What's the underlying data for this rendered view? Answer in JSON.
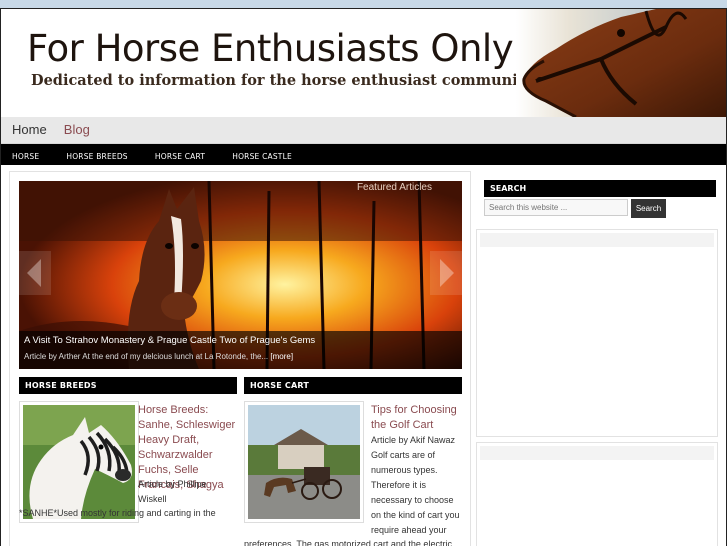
{
  "site": {
    "title": "For Horse Enthusiasts Only",
    "tagline": "Dedicated to information for the horse enthusiast community."
  },
  "primary_nav": [
    {
      "label": "Home"
    },
    {
      "label": "Blog"
    }
  ],
  "secondary_nav": [
    {
      "label": "HORSE"
    },
    {
      "label": "HORSE BREEDS"
    },
    {
      "label": "HORSE CART"
    },
    {
      "label": "HORSE CASTLE"
    }
  ],
  "slider": {
    "label": "Featured Articles",
    "title": "A Visit To Strahov Monastery & Prague Castle Two of Prague's Gems",
    "excerpt": "Article by Arther At the end of my delcious lunch at La Rotonde, the...",
    "more_label": "[more]"
  },
  "columns": [
    {
      "heading": "HORSE BREEDS",
      "post": {
        "title": "Horse Breeds: Sanhe, Schleswiger Heavy Draft, Schwarzwalder Fuchs, Selle Francais, Shagya",
        "byline": "Article by Phillipe Wiskell",
        "body": "*SANHE*Used mostly for riding and carting in the"
      }
    },
    {
      "heading": "HORSE CART",
      "post": {
        "title": "Tips for Choosing the Golf Cart",
        "byline": "Article by Akif Nawaz Golf carts are of numerous types. Therefore it is necessary to choose on the kind of cart you require ahead your",
        "body": "preferences. The gas motorized cart and the electric"
      }
    }
  ],
  "sidebar": {
    "search": {
      "heading": "SEARCH",
      "placeholder": "Search this website ...",
      "button_label": "Search"
    }
  },
  "colors": {
    "link": "#8a4b50",
    "nav_bar": "#000000",
    "heading_bg": "#000000",
    "page_bg": "#c8d9e8"
  }
}
